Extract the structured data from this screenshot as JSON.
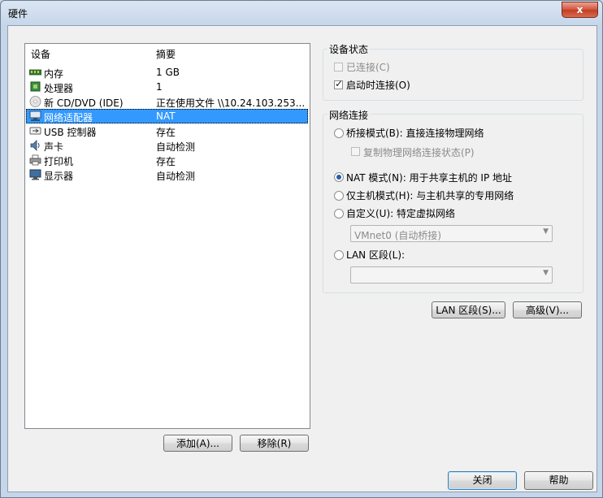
{
  "window": {
    "title": "硬件",
    "close_label": "x"
  },
  "device_list": {
    "columns": {
      "device": "设备",
      "summary": "摘要"
    },
    "rows": [
      {
        "name": "内存",
        "summary": "1 GB",
        "icon": "memory-icon"
      },
      {
        "name": "处理器",
        "summary": "1",
        "icon": "processor-icon"
      },
      {
        "name": "新 CD/DVD (IDE)",
        "summary": "正在使用文件 \\\\10.24.103.253...",
        "icon": "cd-dvd-icon"
      },
      {
        "name": "网络适配器",
        "summary": "NAT",
        "icon": "network-adapter-icon",
        "selected": true
      },
      {
        "name": "USB 控制器",
        "summary": "存在",
        "icon": "usb-icon"
      },
      {
        "name": "声卡",
        "summary": "自动检测",
        "icon": "sound-card-icon"
      },
      {
        "name": "打印机",
        "summary": "存在",
        "icon": "printer-icon"
      },
      {
        "name": "显示器",
        "summary": "自动检测",
        "icon": "display-icon"
      }
    ],
    "add_label": "添加(A)...",
    "remove_label": "移除(R)"
  },
  "device_status": {
    "title": "设备状态",
    "connected": {
      "label": "已连接(C)",
      "checked": false,
      "disabled": true
    },
    "connect_on_start": {
      "label": "启动时连接(O)",
      "checked": true
    }
  },
  "network_connection": {
    "title": "网络连接",
    "bridged": "桥接模式(B): 直接连接物理网络",
    "replicate": "复制物理网络连接状态(P)",
    "nat": "NAT 模式(N): 用于共享主机的 IP 地址",
    "host_only": "仅主机模式(H): 与主机共享的专用网络",
    "custom": "自定义(U): 特定虚拟网络",
    "custom_value": "VMnet0 (自动桥接)",
    "lan": "LAN 区段(L):",
    "lan_value": "",
    "selected": "nat"
  },
  "buttons": {
    "lan_segments": "LAN 区段(S)...",
    "advanced": "高级(V)...",
    "close": "关闭",
    "help": "帮助"
  },
  "colors": {
    "selection": "#3399ff",
    "titlebar": "#c6d6ea",
    "close": "#c13d22"
  }
}
